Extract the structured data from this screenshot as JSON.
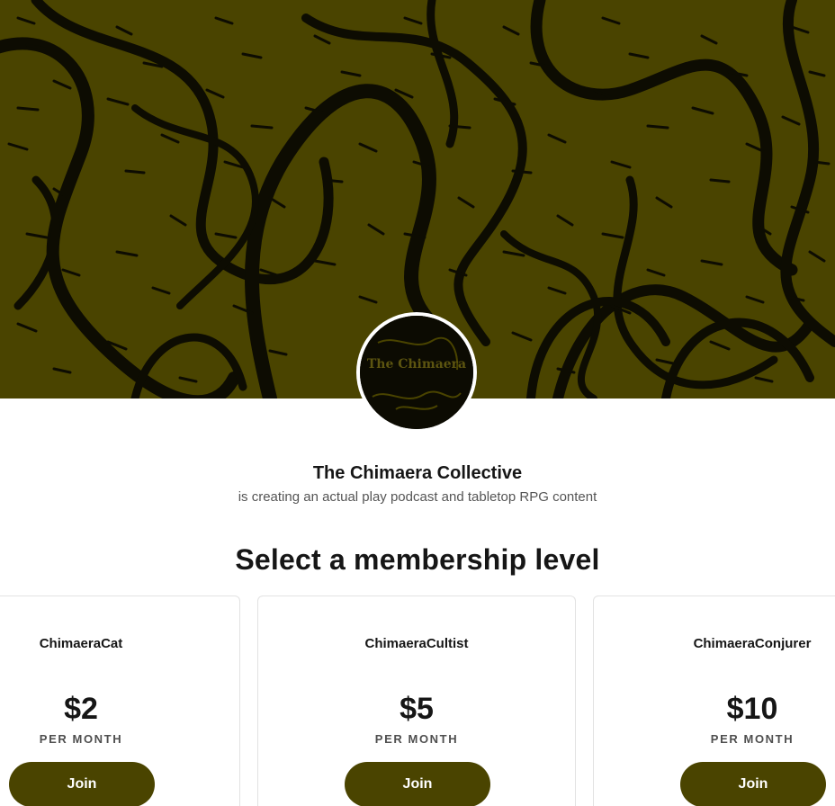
{
  "colors": {
    "brand": "#4a4400",
    "cover_ink": "#0d0c02",
    "text_primary": "#161616",
    "text_secondary": "#555555",
    "card_border": "#e2e2e2"
  },
  "cover": {
    "icon": "cover-artwork"
  },
  "avatar": {
    "logo_text": "The Chimaera"
  },
  "creator": {
    "name": "The Chimaera Collective",
    "tagline": "is creating an actual play podcast and tabletop RPG content"
  },
  "membership": {
    "title": "Select a membership level",
    "tiers": [
      {
        "name": "ChimaeraCat",
        "price": "$2",
        "period": "PER MONTH",
        "button": "Join"
      },
      {
        "name": "ChimaeraCultist",
        "price": "$5",
        "period": "PER MONTH",
        "button": "Join"
      },
      {
        "name": "ChimaeraConjurer",
        "price": "$10",
        "period": "PER MONTH",
        "button": "Join"
      }
    ]
  }
}
